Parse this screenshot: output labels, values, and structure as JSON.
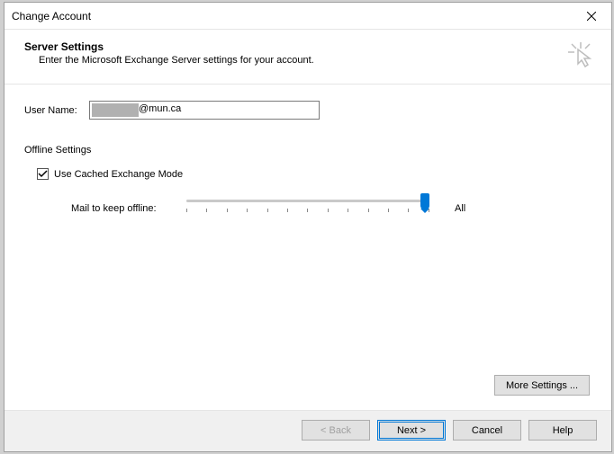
{
  "title": "Change Account",
  "header": {
    "title": "Server Settings",
    "subtitle": "Enter the Microsoft Exchange Server settings for your account."
  },
  "fields": {
    "username_label": "User Name:",
    "username_value": "@mun.ca"
  },
  "offline": {
    "heading": "Offline Settings",
    "cached_label": "Use Cached Exchange Mode",
    "cached_checked": true,
    "slider_label": "Mail to keep offline:",
    "slider_value": "All"
  },
  "buttons": {
    "more_settings": "More Settings ...",
    "back": "< Back",
    "next": "Next >",
    "cancel": "Cancel",
    "help": "Help"
  }
}
